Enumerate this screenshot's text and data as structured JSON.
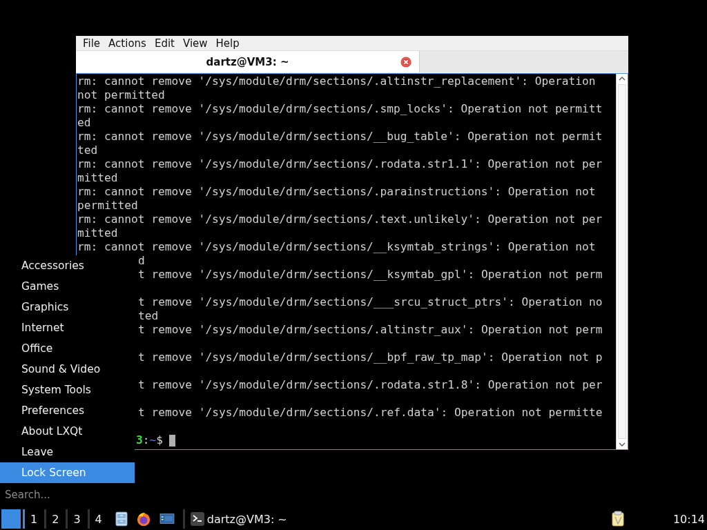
{
  "terminal_window": {
    "menu": [
      "File",
      "Actions",
      "Edit",
      "View",
      "Help"
    ],
    "tabs": [
      {
        "label": "dartz@VM3: ~",
        "selected": true
      }
    ],
    "lines": [
      {
        "kind": "text",
        "text": "rm: cannot remove '/sys/module/drm/sections/.altinstr_replacement': Operation"
      },
      {
        "kind": "text",
        "text": "not permitted"
      },
      {
        "kind": "text",
        "text": "rm: cannot remove '/sys/module/drm/sections/.smp_locks': Operation not permitt"
      },
      {
        "kind": "text",
        "text": "ed"
      },
      {
        "kind": "text",
        "text": "rm: cannot remove '/sys/module/drm/sections/__bug_table': Operation not permit"
      },
      {
        "kind": "text",
        "text": "ted"
      },
      {
        "kind": "text",
        "text": "rm: cannot remove '/sys/module/drm/sections/.rodata.str1.1': Operation not per"
      },
      {
        "kind": "text",
        "text": "mitted"
      },
      {
        "kind": "text",
        "text": "rm: cannot remove '/sys/module/drm/sections/.parainstructions': Operation not"
      },
      {
        "kind": "text",
        "text": "permitted"
      },
      {
        "kind": "text",
        "text": "rm: cannot remove '/sys/module/drm/sections/.text.unlikely': Operation not per"
      },
      {
        "kind": "text",
        "text": "mitted"
      },
      {
        "kind": "text",
        "text": "rm: cannot remove '/sys/module/drm/sections/__ksymtab_strings': Operation not"
      },
      {
        "kind": "covered",
        "text": "d"
      },
      {
        "kind": "covered",
        "text": "t remove '/sys/module/drm/sections/__ksymtab_gpl': Operation not perm"
      },
      {
        "kind": "blank"
      },
      {
        "kind": "covered",
        "text": "t remove '/sys/module/drm/sections/___srcu_struct_ptrs': Operation no"
      },
      {
        "kind": "covered",
        "text": "ted"
      },
      {
        "kind": "covered",
        "text": "t remove '/sys/module/drm/sections/.altinstr_aux': Operation not perm"
      },
      {
        "kind": "blank"
      },
      {
        "kind": "covered",
        "text": "t remove '/sys/module/drm/sections/__bpf_raw_tp_map': Operation not p"
      },
      {
        "kind": "blank"
      },
      {
        "kind": "covered",
        "text": "t remove '/sys/module/drm/sections/.rodata.str1.8': Operation not per"
      },
      {
        "kind": "blank"
      },
      {
        "kind": "covered",
        "text": "t remove '/sys/module/drm/sections/.ref.data': Operation not permitte"
      },
      {
        "kind": "blank"
      },
      {
        "kind": "prompt",
        "host": "3",
        "separator": ":",
        "path": "~",
        "symbol": "$"
      }
    ]
  },
  "start_menu": {
    "items": [
      {
        "label": "Accessories",
        "selected": false
      },
      {
        "label": "Games",
        "selected": false
      },
      {
        "label": "Graphics",
        "selected": false
      },
      {
        "label": "Internet",
        "selected": false
      },
      {
        "label": "Office",
        "selected": false
      },
      {
        "label": "Sound & Video",
        "selected": false
      },
      {
        "label": "System Tools",
        "selected": false
      },
      {
        "label": "Preferences",
        "selected": false
      },
      {
        "label": "About LXQt",
        "selected": false
      },
      {
        "label": "Leave",
        "selected": false
      },
      {
        "label": "Lock Screen",
        "selected": true
      }
    ],
    "search": {
      "placeholder": "Search..."
    }
  },
  "taskbar": {
    "desktops": [
      {
        "label": "1",
        "selected": true
      },
      {
        "label": "2",
        "selected": false
      },
      {
        "label": "3",
        "selected": false
      },
      {
        "label": "4",
        "selected": false
      }
    ],
    "launchers": [
      {
        "kind": "files"
      },
      {
        "kind": "browser"
      },
      {
        "kind": "display"
      }
    ],
    "tasks": [
      {
        "label": "dartz@VM3: ~"
      }
    ],
    "tray": [
      {
        "kind": "clipboard"
      }
    ],
    "clock": "10:14"
  }
}
